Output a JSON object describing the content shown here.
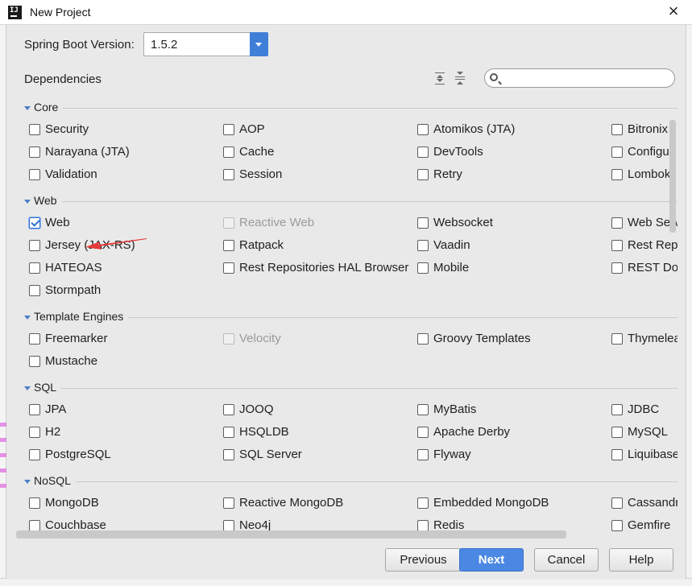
{
  "window": {
    "title": "New Project",
    "close_glyph": "×",
    "app_icon_text": "IJ"
  },
  "form": {
    "spring_boot_label": "Spring Boot Version:",
    "spring_boot_value": "1.5.2",
    "dependencies_label": "Dependencies",
    "search_placeholder": "",
    "expand_all_icon": "expand-all-icon",
    "collapse_all_icon": "collapse-all-icon"
  },
  "sections": [
    {
      "name": "Core",
      "items": [
        {
          "label": "Security",
          "checked": false,
          "enabled": true
        },
        {
          "label": "AOP",
          "checked": false,
          "enabled": true
        },
        {
          "label": "Atomikos (JTA)",
          "checked": false,
          "enabled": true
        },
        {
          "label": "Bitronix (",
          "checked": false,
          "enabled": true
        },
        {
          "label": "Narayana (JTA)",
          "checked": false,
          "enabled": true
        },
        {
          "label": "Cache",
          "checked": false,
          "enabled": true
        },
        {
          "label": "DevTools",
          "checked": false,
          "enabled": true
        },
        {
          "label": "Configur",
          "checked": false,
          "enabled": true
        },
        {
          "label": "Validation",
          "checked": false,
          "enabled": true
        },
        {
          "label": "Session",
          "checked": false,
          "enabled": true
        },
        {
          "label": "Retry",
          "checked": false,
          "enabled": true
        },
        {
          "label": "Lombok",
          "checked": false,
          "enabled": true
        }
      ]
    },
    {
      "name": "Web",
      "items": [
        {
          "label": "Web",
          "checked": true,
          "enabled": true
        },
        {
          "label": "Reactive Web",
          "checked": false,
          "enabled": false
        },
        {
          "label": "Websocket",
          "checked": false,
          "enabled": true
        },
        {
          "label": "Web Serv",
          "checked": false,
          "enabled": true
        },
        {
          "label": "Jersey (JAX-RS)",
          "checked": false,
          "enabled": true
        },
        {
          "label": "Ratpack",
          "checked": false,
          "enabled": true
        },
        {
          "label": "Vaadin",
          "checked": false,
          "enabled": true
        },
        {
          "label": "Rest Repo",
          "checked": false,
          "enabled": true
        },
        {
          "label": "HATEOAS",
          "checked": false,
          "enabled": true
        },
        {
          "label": "Rest Repositories HAL Browser",
          "checked": false,
          "enabled": true
        },
        {
          "label": "Mobile",
          "checked": false,
          "enabled": true
        },
        {
          "label": "REST Doc",
          "checked": false,
          "enabled": true
        },
        {
          "label": "Stormpath",
          "checked": false,
          "enabled": true
        }
      ]
    },
    {
      "name": "Template Engines",
      "items": [
        {
          "label": "Freemarker",
          "checked": false,
          "enabled": true
        },
        {
          "label": "Velocity",
          "checked": false,
          "enabled": false
        },
        {
          "label": "Groovy Templates",
          "checked": false,
          "enabled": true
        },
        {
          "label": "Thymelea",
          "checked": false,
          "enabled": true
        },
        {
          "label": "Mustache",
          "checked": false,
          "enabled": true
        }
      ]
    },
    {
      "name": "SQL",
      "items": [
        {
          "label": "JPA",
          "checked": false,
          "enabled": true
        },
        {
          "label": "JOOQ",
          "checked": false,
          "enabled": true
        },
        {
          "label": "MyBatis",
          "checked": false,
          "enabled": true
        },
        {
          "label": "JDBC",
          "checked": false,
          "enabled": true
        },
        {
          "label": "H2",
          "checked": false,
          "enabled": true
        },
        {
          "label": "HSQLDB",
          "checked": false,
          "enabled": true
        },
        {
          "label": "Apache Derby",
          "checked": false,
          "enabled": true
        },
        {
          "label": "MySQL",
          "checked": false,
          "enabled": true
        },
        {
          "label": "PostgreSQL",
          "checked": false,
          "enabled": true
        },
        {
          "label": "SQL Server",
          "checked": false,
          "enabled": true
        },
        {
          "label": "Flyway",
          "checked": false,
          "enabled": true
        },
        {
          "label": "Liquibase",
          "checked": false,
          "enabled": true
        }
      ]
    },
    {
      "name": "NoSQL",
      "items": [
        {
          "label": "MongoDB",
          "checked": false,
          "enabled": true
        },
        {
          "label": "Reactive MongoDB",
          "checked": false,
          "enabled": true
        },
        {
          "label": "Embedded MongoDB",
          "checked": false,
          "enabled": true
        },
        {
          "label": "Cassandr",
          "checked": false,
          "enabled": true
        },
        {
          "label": "Couchbase",
          "checked": false,
          "enabled": true
        },
        {
          "label": "Neo4j",
          "checked": false,
          "enabled": true
        },
        {
          "label": "Redis",
          "checked": false,
          "enabled": true
        },
        {
          "label": "Gemfire",
          "checked": false,
          "enabled": true
        }
      ]
    }
  ],
  "buttons": {
    "previous": "Previous",
    "next": "Next",
    "cancel": "Cancel",
    "help": "Help"
  },
  "colors": {
    "accent": "#4a88e4",
    "annotation_arrow": "#e8393a",
    "section_triangle": "#4a7fc6"
  }
}
